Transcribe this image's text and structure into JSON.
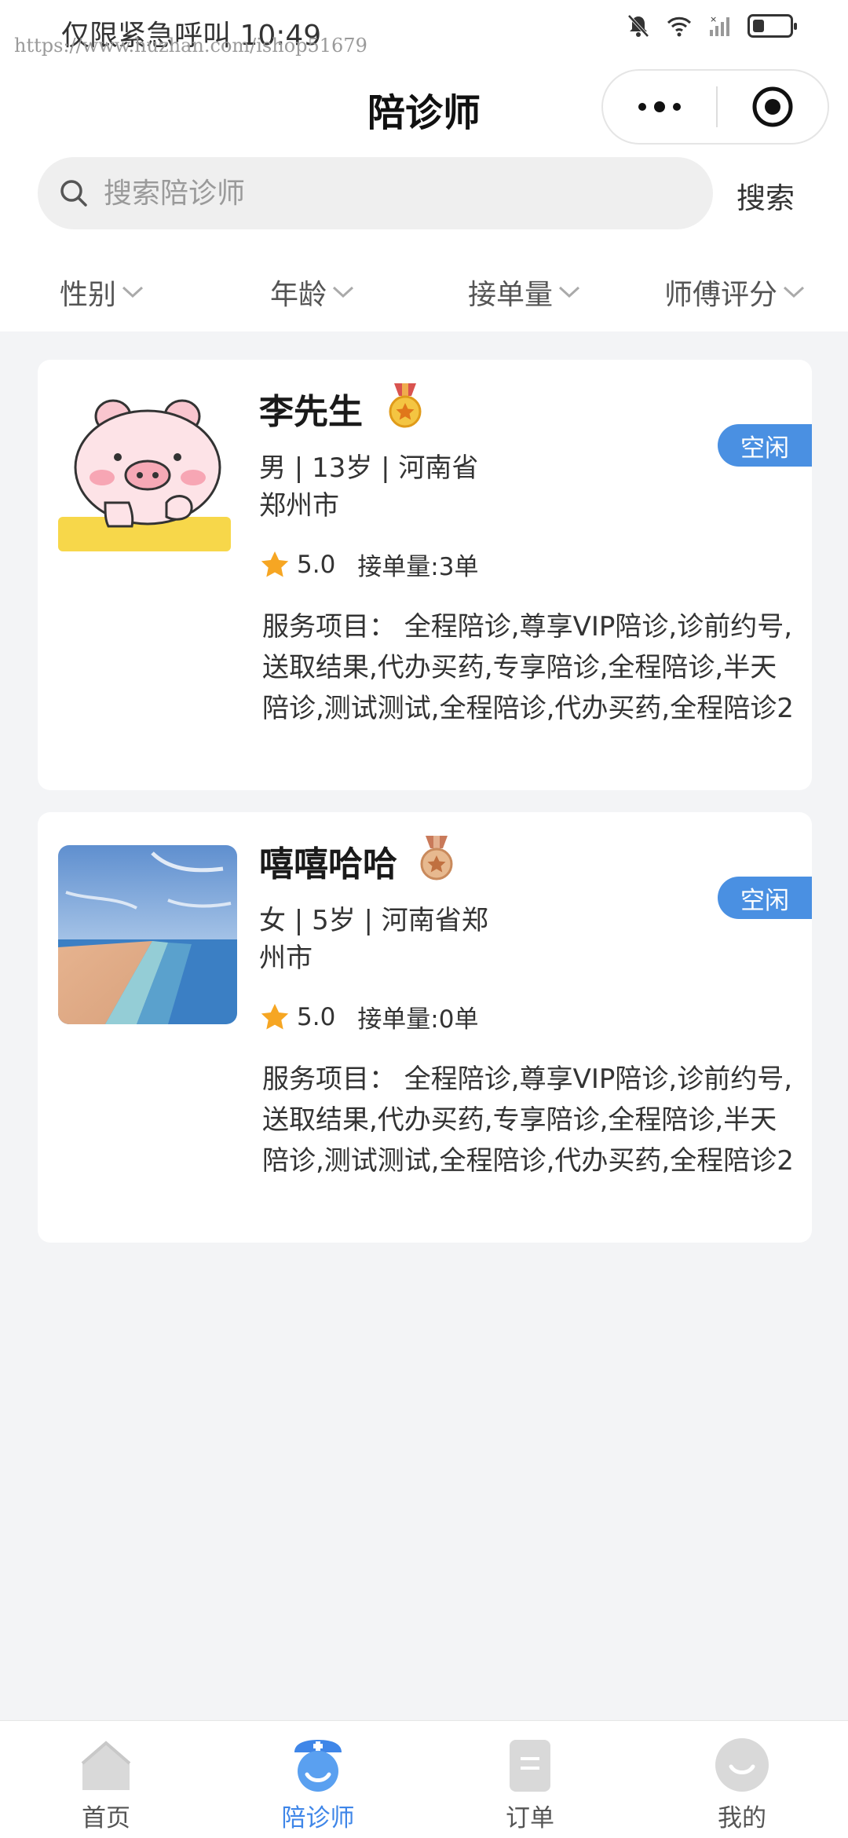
{
  "status_bar": {
    "left_text": "仅限紧急呼叫 10:49",
    "watermark": "https://www.huzhan.com/ishop51679"
  },
  "nav": {
    "title": "陪诊师"
  },
  "search": {
    "placeholder": "搜索陪诊师",
    "button_label": "搜索"
  },
  "filters": [
    {
      "label": "性别"
    },
    {
      "label": "年龄"
    },
    {
      "label": "接单量"
    },
    {
      "label": "师傅评分"
    }
  ],
  "escorts": [
    {
      "name": "李先生",
      "medal": "gold-medal-icon",
      "status": "空闲",
      "info": "男 | 13岁 | 河南省郑州市",
      "rating": "5.0",
      "orders": "接单量:3单",
      "services": "服务项目：  全程陪诊,尊享VIP陪诊,诊前约号,送取结果,代办买药,专享陪诊,全程陪诊,半天陪诊,测试测试,全程陪诊,代办买药,全程陪诊2"
    },
    {
      "name": "嘻嘻哈哈",
      "medal": "bronze-medal-icon",
      "status": "空闲",
      "info": "女 | 5岁 | 河南省郑州市",
      "rating": "5.0",
      "orders": "接单量:0单",
      "services": "服务项目：  全程陪诊,尊享VIP陪诊,诊前约号,送取结果,代办买药,专享陪诊,全程陪诊,半天陪诊,测试测试,全程陪诊,代办买药,全程陪诊2"
    }
  ],
  "tabbar": [
    {
      "label": "首页",
      "icon": "home-icon"
    },
    {
      "label": "陪诊师",
      "icon": "escort-icon",
      "active": true
    },
    {
      "label": "订单",
      "icon": "order-icon"
    },
    {
      "label": "我的",
      "icon": "profile-icon"
    }
  ],
  "colors": {
    "accent": "#3f86e8",
    "badge": "#4a90e2",
    "background": "#f3f4f6",
    "star": "#f6a623"
  }
}
